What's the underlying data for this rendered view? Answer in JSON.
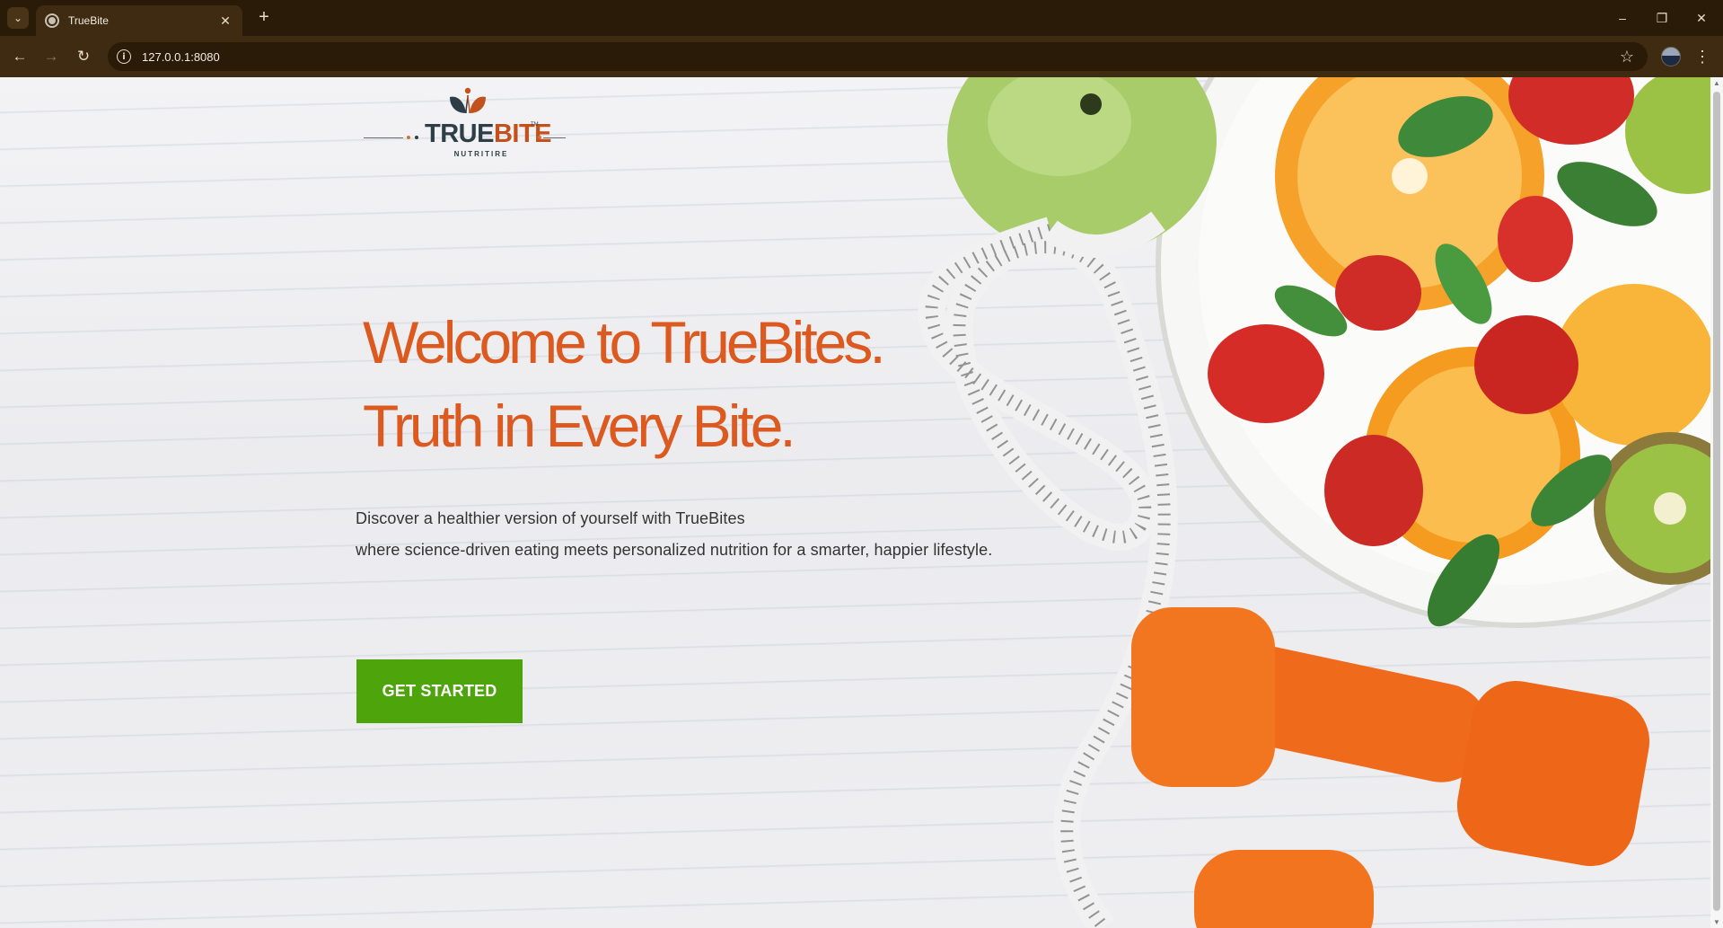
{
  "browser": {
    "tab_title": "TrueBite",
    "url": "127.0.0.1:8080"
  },
  "logo": {
    "word_true": "TRUE",
    "word_bite": "BITE",
    "tm": "TM",
    "subtitle": "NUTRITIRE"
  },
  "hero": {
    "headline_line1": "Welcome to TrueBites.",
    "headline_line2": "Truth in Every Bite.",
    "description_line1": "Discover a healthier version of yourself with TrueBites",
    "description_line2": "where science-driven eating meets personalized nutrition for a smarter, happier lifestyle.",
    "cta_label": "GET STARTED"
  },
  "colors": {
    "accent_orange": "#dc5a1f",
    "cta_green": "#4ea40b",
    "logo_dark": "#2d3e46",
    "logo_orange": "#c2511b"
  }
}
